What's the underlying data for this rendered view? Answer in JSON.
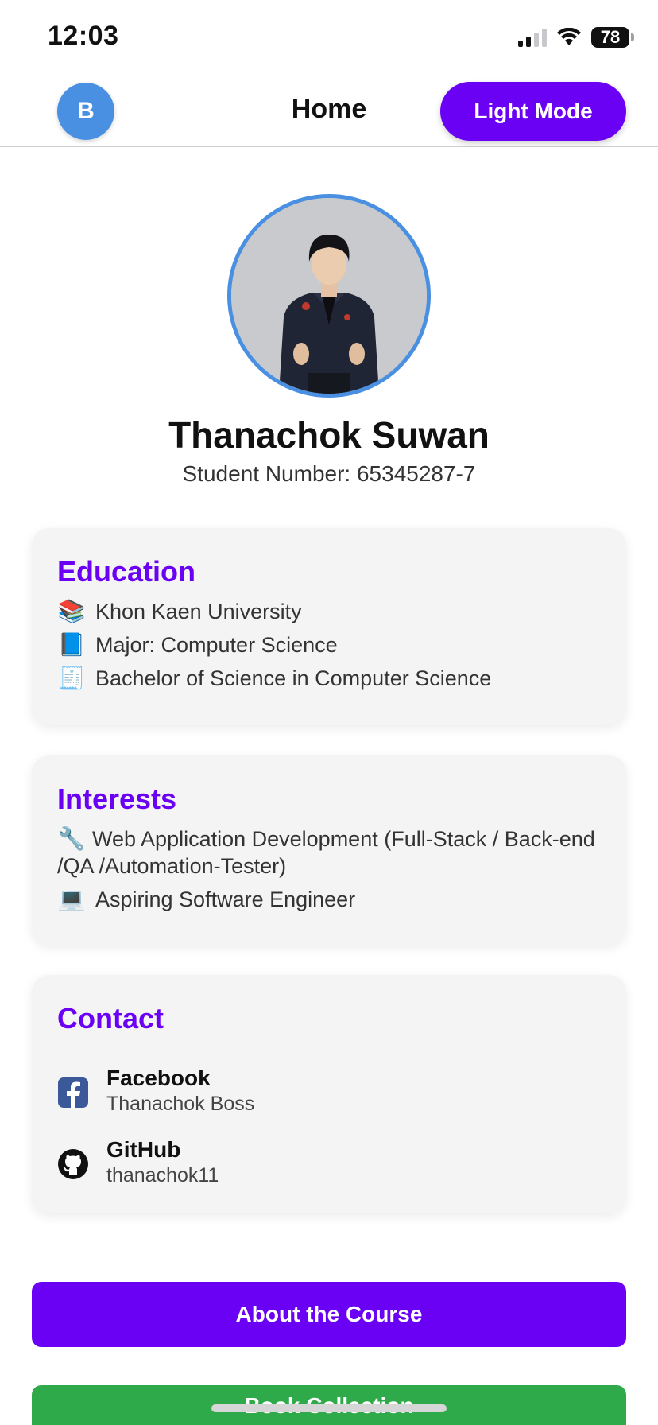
{
  "status_bar": {
    "time": "12:03",
    "battery": "78"
  },
  "header": {
    "avatar_initial": "B",
    "title": "Home",
    "mode_button": "Light Mode"
  },
  "profile": {
    "name": "Thanachok Suwan",
    "student_number": "Student Number: 65345287-7"
  },
  "education": {
    "title": "Education",
    "items": [
      {
        "icon": "📚",
        "text": "Khon Kaen University"
      },
      {
        "icon": "📘",
        "text": "Major: Computer Science"
      },
      {
        "icon": "🧾",
        "text": "Bachelor of Science in Computer Science"
      }
    ]
  },
  "interests": {
    "title": "Interests",
    "items": [
      {
        "icon": "🔧",
        "text": "Web Application Development (Full-Stack / Back-end /QA /Automation-Tester)"
      },
      {
        "icon": "💻",
        "text": "Aspiring Software Engineer"
      }
    ]
  },
  "contact": {
    "title": "Contact",
    "items": [
      {
        "label": "Facebook",
        "value": "Thanachok Boss",
        "icon": "facebook-icon",
        "color": "#3b5998"
      },
      {
        "label": "GitHub",
        "value": "thanachok11",
        "icon": "github-icon",
        "color": "#111111"
      }
    ]
  },
  "buttons": {
    "about_course": "About the Course",
    "book_collection": "Book Collection"
  },
  "colors": {
    "accent": "#6a00f4",
    "avatar_blue": "#4a90e2",
    "green": "#2faa4a",
    "card_bg": "#f4f4f4"
  }
}
